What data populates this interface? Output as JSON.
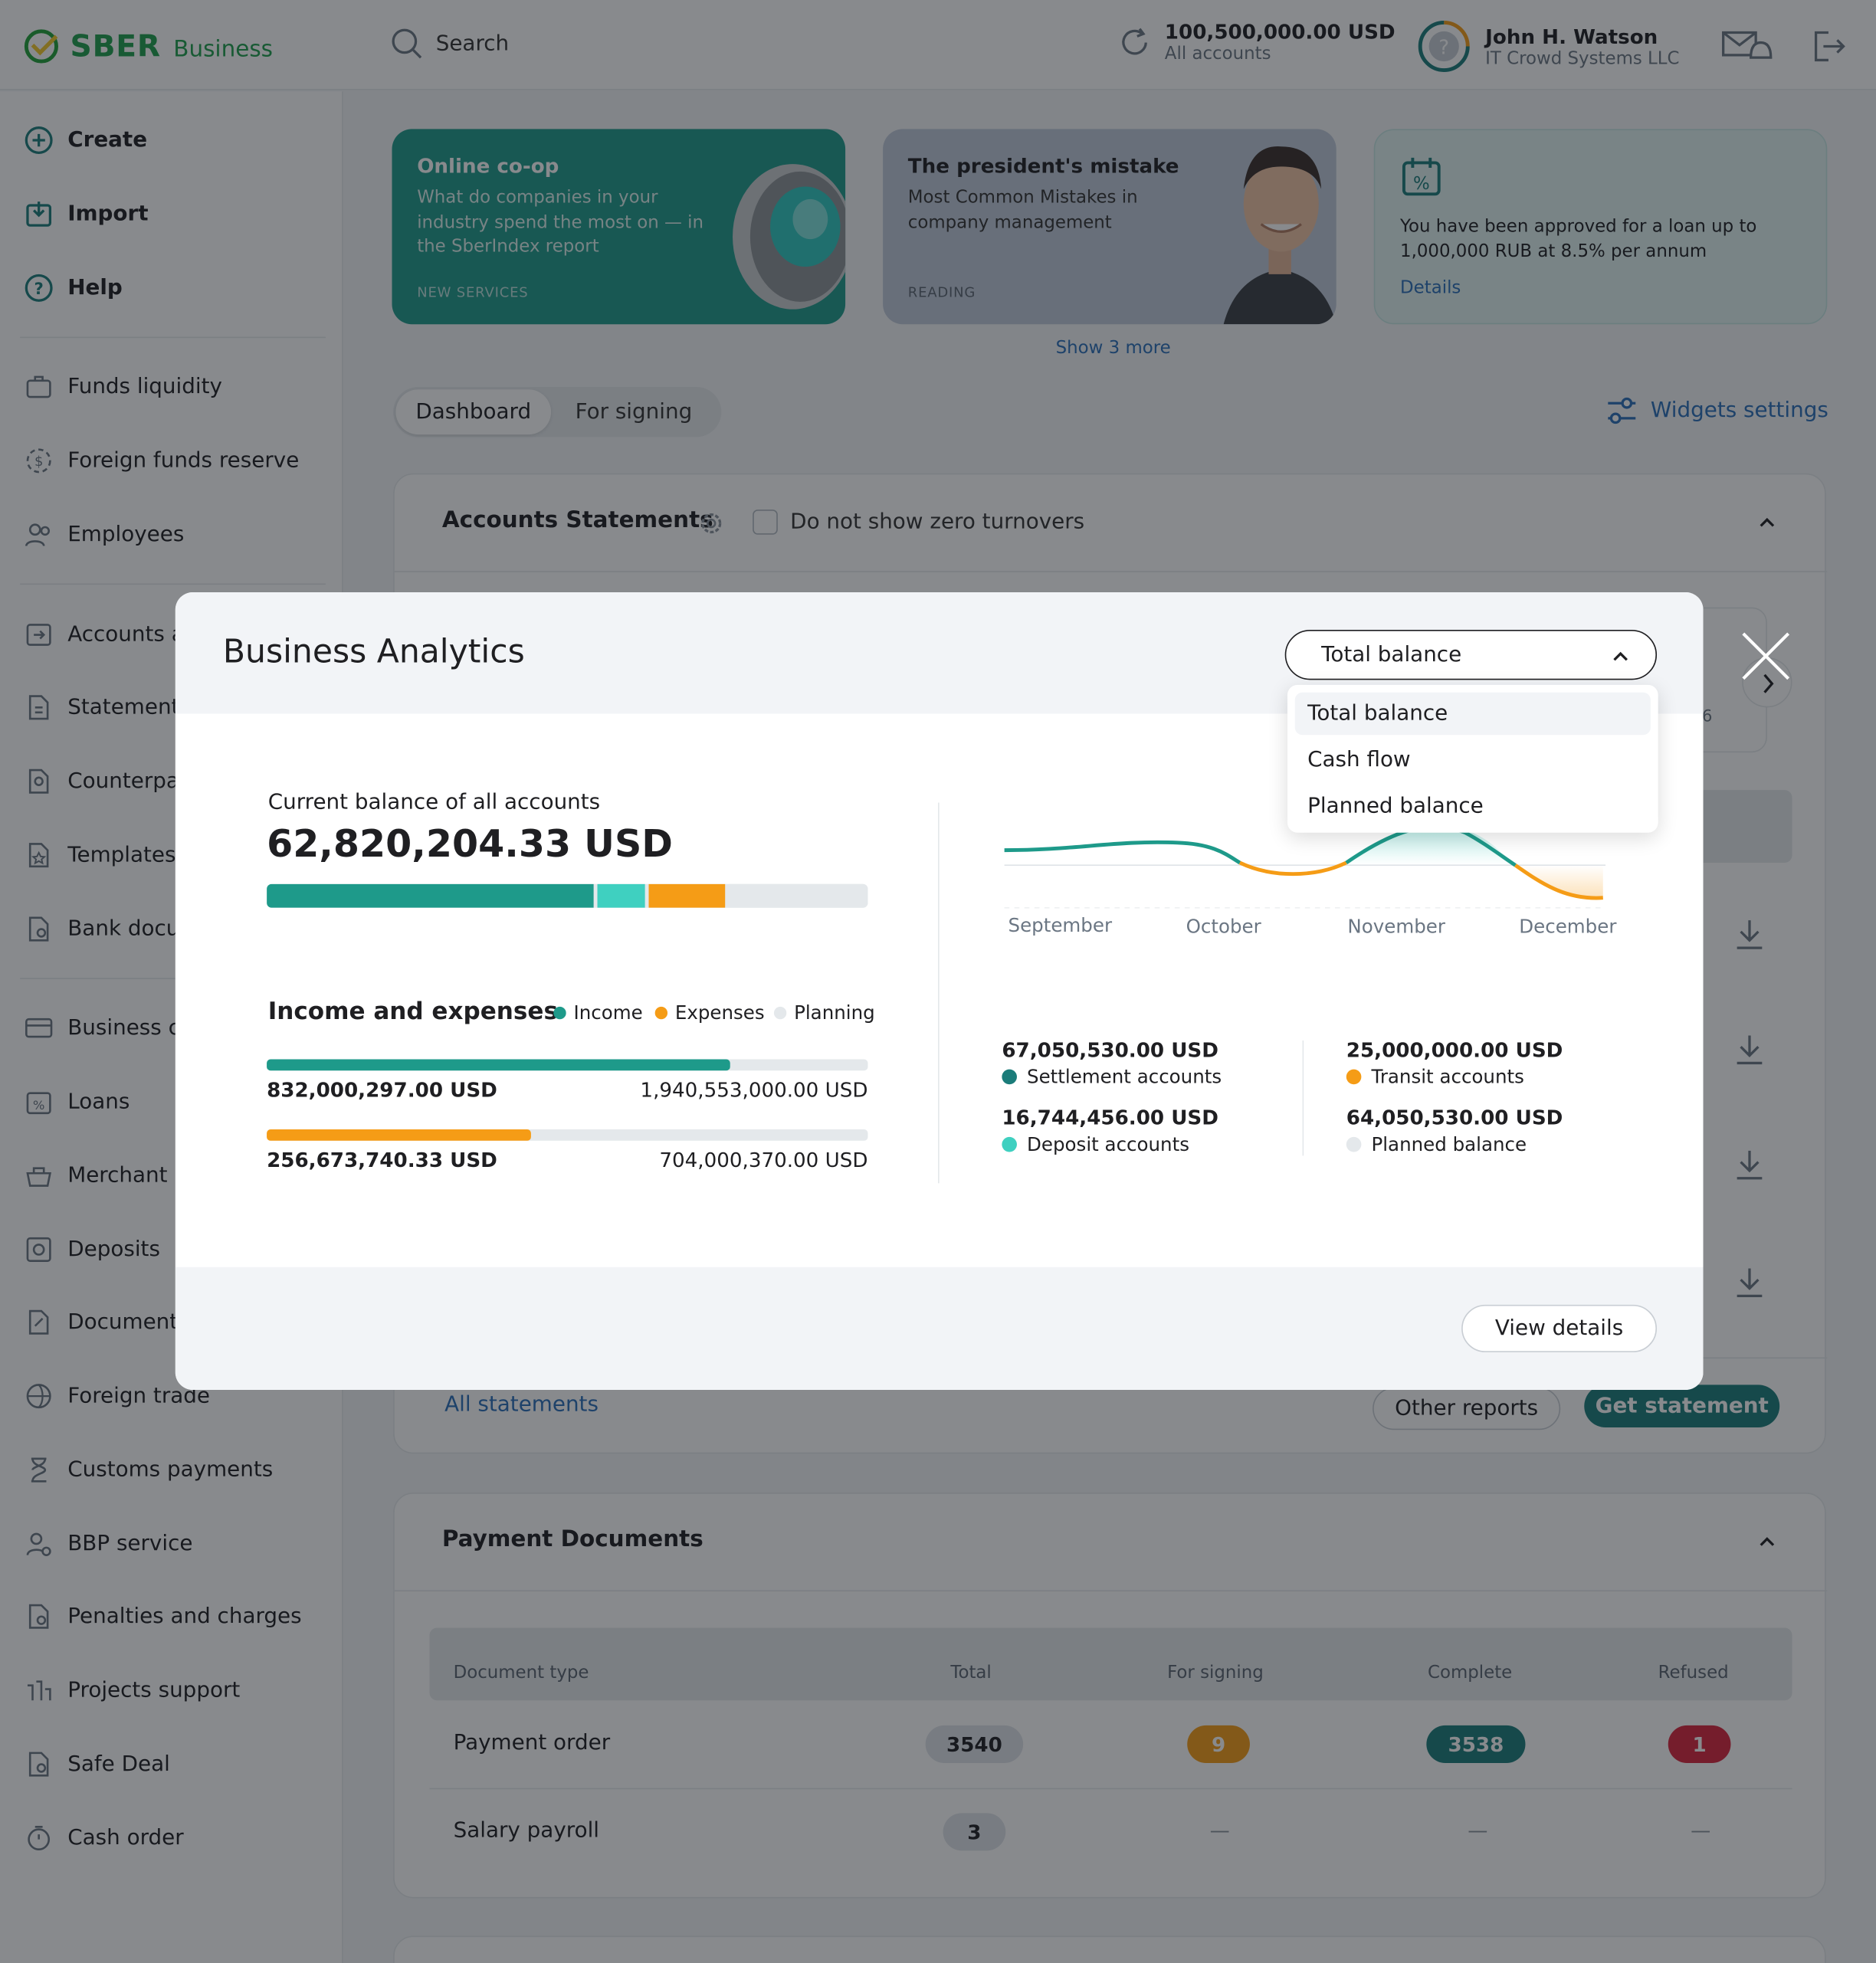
{
  "header": {
    "brand": "SBER",
    "brand_sub": "Business",
    "search_label": "Search",
    "balance_amount": "100,500,000.00 USD",
    "balance_caption": "All accounts",
    "user_name": "John H. Watson",
    "user_company": "IT Crowd Systems LLC",
    "icons": [
      "refresh-icon",
      "help-avatar-icon",
      "mail-bell-icon",
      "logout-icon"
    ]
  },
  "sidebar": {
    "top_items": [
      {
        "label": "Create",
        "icon": "plus-circle-icon"
      },
      {
        "label": "Import",
        "icon": "import-icon"
      },
      {
        "label": "Help",
        "icon": "question-icon"
      }
    ],
    "group1": [
      {
        "label": "Funds liquidity"
      },
      {
        "label": "Foreign funds reserve"
      },
      {
        "label": "Employees"
      }
    ],
    "group2": [
      {
        "label": "Accounts a"
      },
      {
        "label": "Statement"
      },
      {
        "label": "Counterpar"
      },
      {
        "label": "Templates"
      },
      {
        "label": "Bank docur"
      }
    ],
    "group3": [
      {
        "label": "Business ca"
      },
      {
        "label": "Loans"
      },
      {
        "label": "Merchant a"
      },
      {
        "label": "Deposits"
      },
      {
        "label": "Documents"
      },
      {
        "label": "Foreign trade"
      },
      {
        "label": "Customs payments"
      },
      {
        "label": "BBP service"
      },
      {
        "label": "Penalties and charges"
      },
      {
        "label": "Projects support"
      },
      {
        "label": "Safe Deal"
      },
      {
        "label": "Cash order"
      }
    ]
  },
  "promos": [
    {
      "title": "Online co-op",
      "desc": "What do companies in your industry spend the most on — in the SberIndex report",
      "tag": "NEW SERVICES",
      "bg": "#1e9a8a"
    },
    {
      "title": "The president's mistake",
      "desc": "Most Common Mistakes in company management",
      "tag": "READING",
      "bg": "#bfc9d8"
    },
    {
      "title": "",
      "desc": "You have been approved for a loan up to 1,000,000 RUB at 8.5% per annum",
      "link": "Details",
      "bg": "#e0f2f1"
    }
  ],
  "show_more": "Show 3 more",
  "tabs": {
    "dashboard": "Dashboard",
    "signing": "For signing"
  },
  "widgets_settings": "Widgets settings",
  "accounts": {
    "title": "Accounts Statements",
    "zero_label": "Do not show zero turnovers",
    "all_statements": "All statements",
    "other_reports": "Other reports",
    "get_statement": "Get statement",
    "peek_digit": "6"
  },
  "payments": {
    "title": "Payment Documents",
    "columns": [
      "Document type",
      "Total",
      "For signing",
      "Complete",
      "Refused"
    ],
    "rows": [
      {
        "type": "Payment order",
        "total": "3540",
        "signing": "9",
        "complete": "3538",
        "refused": "1"
      },
      {
        "type": "Salary payroll",
        "total": "3",
        "signing": "—",
        "complete": "—",
        "refused": "—"
      }
    ]
  },
  "modal": {
    "title": "Business Analytics",
    "select_value": "Total balance",
    "options": [
      "Total balance",
      "Cash flow",
      "Planned balance"
    ],
    "current_label": "Current balance of all accounts",
    "current_amount": "62,820,204.33 USD",
    "balance_split": [
      {
        "name": "Settlement",
        "fraction": 0.555,
        "color": "#1e9a8a"
      },
      {
        "name": "Deposit",
        "fraction": 0.08,
        "color": "#3fd0c0"
      },
      {
        "name": "Transit",
        "fraction": 0.13,
        "color": "#f59c16"
      },
      {
        "name": "Planned",
        "fraction": 0.235,
        "color": "#e4e8eb"
      }
    ],
    "ie_title": "Income and expenses",
    "legend": {
      "income": "Income",
      "expenses": "Expenses",
      "planning": "Planning"
    },
    "income_amount": "832,000,297.00 USD",
    "income_plan": "1,940,553,000.00 USD",
    "income_fraction": 0.77,
    "expense_amount": "256,673,740.33 USD",
    "expense_plan": "704,000,370.00 USD",
    "expense_fraction": 0.44,
    "months": [
      "September",
      "October",
      "November",
      "December"
    ],
    "stats": [
      {
        "value": "67,050,530.00 USD",
        "label": "Settlement accounts",
        "color": "#1b7c7a"
      },
      {
        "value": "16,744,456.00 USD",
        "label": "Deposit accounts",
        "color": "#3fd0c0"
      },
      {
        "value": "25,000,000.00 USD",
        "label": "Transit accounts",
        "color": "#f59c16"
      },
      {
        "value": "64,050,530.00 USD",
        "label": "Planned balance",
        "color": "#e4e8eb"
      }
    ],
    "view_details": "View details"
  }
}
